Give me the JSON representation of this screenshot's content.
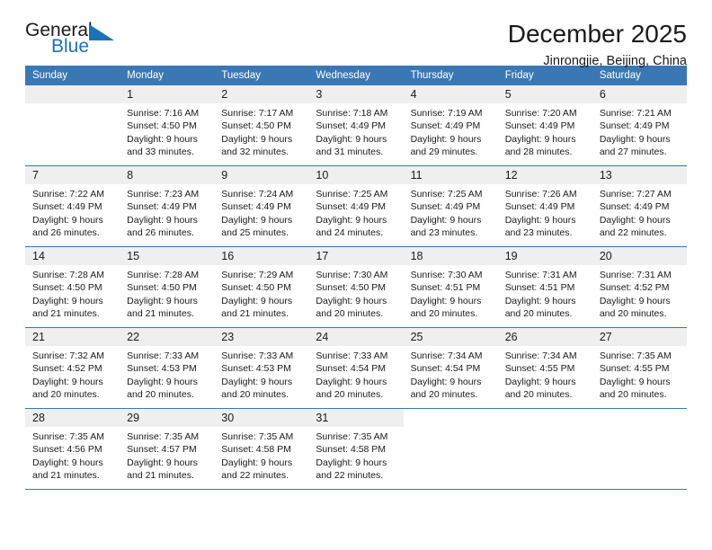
{
  "brand": {
    "name_part1": "General",
    "name_part2": "Blue",
    "logo_icon": "triangle-flag-icon",
    "accent_color": "#1b72b8"
  },
  "header": {
    "month_title": "December 2025",
    "location": "Jinrongjie, Beijing, China"
  },
  "calendar": {
    "header_bg": "#3a78b5",
    "daynum_bg": "#efefef",
    "weekday_headers": [
      "Sunday",
      "Monday",
      "Tuesday",
      "Wednesday",
      "Thursday",
      "Friday",
      "Saturday"
    ],
    "weeks": [
      [
        {
          "day": "",
          "sunrise": "",
          "sunset": "",
          "daylight_line1": "",
          "daylight_line2": "",
          "empty": true
        },
        {
          "day": "1",
          "sunrise": "Sunrise: 7:16 AM",
          "sunset": "Sunset: 4:50 PM",
          "daylight_line1": "Daylight: 9 hours",
          "daylight_line2": "and 33 minutes."
        },
        {
          "day": "2",
          "sunrise": "Sunrise: 7:17 AM",
          "sunset": "Sunset: 4:50 PM",
          "daylight_line1": "Daylight: 9 hours",
          "daylight_line2": "and 32 minutes."
        },
        {
          "day": "3",
          "sunrise": "Sunrise: 7:18 AM",
          "sunset": "Sunset: 4:49 PM",
          "daylight_line1": "Daylight: 9 hours",
          "daylight_line2": "and 31 minutes."
        },
        {
          "day": "4",
          "sunrise": "Sunrise: 7:19 AM",
          "sunset": "Sunset: 4:49 PM",
          "daylight_line1": "Daylight: 9 hours",
          "daylight_line2": "and 29 minutes."
        },
        {
          "day": "5",
          "sunrise": "Sunrise: 7:20 AM",
          "sunset": "Sunset: 4:49 PM",
          "daylight_line1": "Daylight: 9 hours",
          "daylight_line2": "and 28 minutes."
        },
        {
          "day": "6",
          "sunrise": "Sunrise: 7:21 AM",
          "sunset": "Sunset: 4:49 PM",
          "daylight_line1": "Daylight: 9 hours",
          "daylight_line2": "and 27 minutes."
        }
      ],
      [
        {
          "day": "7",
          "sunrise": "Sunrise: 7:22 AM",
          "sunset": "Sunset: 4:49 PM",
          "daylight_line1": "Daylight: 9 hours",
          "daylight_line2": "and 26 minutes."
        },
        {
          "day": "8",
          "sunrise": "Sunrise: 7:23 AM",
          "sunset": "Sunset: 4:49 PM",
          "daylight_line1": "Daylight: 9 hours",
          "daylight_line2": "and 26 minutes."
        },
        {
          "day": "9",
          "sunrise": "Sunrise: 7:24 AM",
          "sunset": "Sunset: 4:49 PM",
          "daylight_line1": "Daylight: 9 hours",
          "daylight_line2": "and 25 minutes."
        },
        {
          "day": "10",
          "sunrise": "Sunrise: 7:25 AM",
          "sunset": "Sunset: 4:49 PM",
          "daylight_line1": "Daylight: 9 hours",
          "daylight_line2": "and 24 minutes."
        },
        {
          "day": "11",
          "sunrise": "Sunrise: 7:25 AM",
          "sunset": "Sunset: 4:49 PM",
          "daylight_line1": "Daylight: 9 hours",
          "daylight_line2": "and 23 minutes."
        },
        {
          "day": "12",
          "sunrise": "Sunrise: 7:26 AM",
          "sunset": "Sunset: 4:49 PM",
          "daylight_line1": "Daylight: 9 hours",
          "daylight_line2": "and 23 minutes."
        },
        {
          "day": "13",
          "sunrise": "Sunrise: 7:27 AM",
          "sunset": "Sunset: 4:49 PM",
          "daylight_line1": "Daylight: 9 hours",
          "daylight_line2": "and 22 minutes."
        }
      ],
      [
        {
          "day": "14",
          "sunrise": "Sunrise: 7:28 AM",
          "sunset": "Sunset: 4:50 PM",
          "daylight_line1": "Daylight: 9 hours",
          "daylight_line2": "and 21 minutes."
        },
        {
          "day": "15",
          "sunrise": "Sunrise: 7:28 AM",
          "sunset": "Sunset: 4:50 PM",
          "daylight_line1": "Daylight: 9 hours",
          "daylight_line2": "and 21 minutes."
        },
        {
          "day": "16",
          "sunrise": "Sunrise: 7:29 AM",
          "sunset": "Sunset: 4:50 PM",
          "daylight_line1": "Daylight: 9 hours",
          "daylight_line2": "and 21 minutes."
        },
        {
          "day": "17",
          "sunrise": "Sunrise: 7:30 AM",
          "sunset": "Sunset: 4:50 PM",
          "daylight_line1": "Daylight: 9 hours",
          "daylight_line2": "and 20 minutes."
        },
        {
          "day": "18",
          "sunrise": "Sunrise: 7:30 AM",
          "sunset": "Sunset: 4:51 PM",
          "daylight_line1": "Daylight: 9 hours",
          "daylight_line2": "and 20 minutes."
        },
        {
          "day": "19",
          "sunrise": "Sunrise: 7:31 AM",
          "sunset": "Sunset: 4:51 PM",
          "daylight_line1": "Daylight: 9 hours",
          "daylight_line2": "and 20 minutes."
        },
        {
          "day": "20",
          "sunrise": "Sunrise: 7:31 AM",
          "sunset": "Sunset: 4:52 PM",
          "daylight_line1": "Daylight: 9 hours",
          "daylight_line2": "and 20 minutes."
        }
      ],
      [
        {
          "day": "21",
          "sunrise": "Sunrise: 7:32 AM",
          "sunset": "Sunset: 4:52 PM",
          "daylight_line1": "Daylight: 9 hours",
          "daylight_line2": "and 20 minutes."
        },
        {
          "day": "22",
          "sunrise": "Sunrise: 7:33 AM",
          "sunset": "Sunset: 4:53 PM",
          "daylight_line1": "Daylight: 9 hours",
          "daylight_line2": "and 20 minutes."
        },
        {
          "day": "23",
          "sunrise": "Sunrise: 7:33 AM",
          "sunset": "Sunset: 4:53 PM",
          "daylight_line1": "Daylight: 9 hours",
          "daylight_line2": "and 20 minutes."
        },
        {
          "day": "24",
          "sunrise": "Sunrise: 7:33 AM",
          "sunset": "Sunset: 4:54 PM",
          "daylight_line1": "Daylight: 9 hours",
          "daylight_line2": "and 20 minutes."
        },
        {
          "day": "25",
          "sunrise": "Sunrise: 7:34 AM",
          "sunset": "Sunset: 4:54 PM",
          "daylight_line1": "Daylight: 9 hours",
          "daylight_line2": "and 20 minutes."
        },
        {
          "day": "26",
          "sunrise": "Sunrise: 7:34 AM",
          "sunset": "Sunset: 4:55 PM",
          "daylight_line1": "Daylight: 9 hours",
          "daylight_line2": "and 20 minutes."
        },
        {
          "day": "27",
          "sunrise": "Sunrise: 7:35 AM",
          "sunset": "Sunset: 4:55 PM",
          "daylight_line1": "Daylight: 9 hours",
          "daylight_line2": "and 20 minutes."
        }
      ],
      [
        {
          "day": "28",
          "sunrise": "Sunrise: 7:35 AM",
          "sunset": "Sunset: 4:56 PM",
          "daylight_line1": "Daylight: 9 hours",
          "daylight_line2": "and 21 minutes."
        },
        {
          "day": "29",
          "sunrise": "Sunrise: 7:35 AM",
          "sunset": "Sunset: 4:57 PM",
          "daylight_line1": "Daylight: 9 hours",
          "daylight_line2": "and 21 minutes."
        },
        {
          "day": "30",
          "sunrise": "Sunrise: 7:35 AM",
          "sunset": "Sunset: 4:58 PM",
          "daylight_line1": "Daylight: 9 hours",
          "daylight_line2": "and 22 minutes."
        },
        {
          "day": "31",
          "sunrise": "Sunrise: 7:35 AM",
          "sunset": "Sunset: 4:58 PM",
          "daylight_line1": "Daylight: 9 hours",
          "daylight_line2": "and 22 minutes."
        },
        {
          "day": "",
          "sunrise": "",
          "sunset": "",
          "daylight_line1": "",
          "daylight_line2": "",
          "blank": true
        },
        {
          "day": "",
          "sunrise": "",
          "sunset": "",
          "daylight_line1": "",
          "daylight_line2": "",
          "blank": true
        },
        {
          "day": "",
          "sunrise": "",
          "sunset": "",
          "daylight_line1": "",
          "daylight_line2": "",
          "blank": true
        }
      ]
    ]
  }
}
